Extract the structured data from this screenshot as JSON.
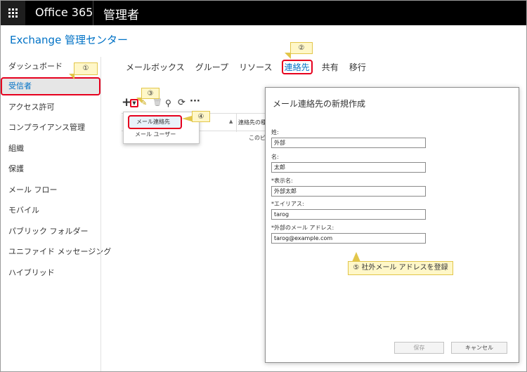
{
  "topbar": {
    "app_name": "Office 365",
    "role": "管理者"
  },
  "eac_title": "Exchange 管理センター",
  "sidebar": {
    "items": [
      {
        "label": "ダッシュボード"
      },
      {
        "label": "受信者"
      },
      {
        "label": "アクセス許可"
      },
      {
        "label": "コンプライアンス管理"
      },
      {
        "label": "組織"
      },
      {
        "label": "保護"
      },
      {
        "label": "メール フロー"
      },
      {
        "label": "モバイル"
      },
      {
        "label": "パブリック フォルダー"
      },
      {
        "label": "ユニファイド メッセージング"
      },
      {
        "label": "ハイブリッド"
      }
    ]
  },
  "tabs": [
    {
      "label": "メールボックス"
    },
    {
      "label": "グループ"
    },
    {
      "label": "リソース"
    },
    {
      "label": "連絡先"
    },
    {
      "label": "共有"
    },
    {
      "label": "移行"
    }
  ],
  "toolbar": {
    "icons": [
      "plus-icon",
      "dropdown-arrow-icon",
      "pencil-icon",
      "trash-icon",
      "search-icon",
      "refresh-icon",
      "more-icon"
    ]
  },
  "grid": {
    "column2": "連絡先の種",
    "empty_text": "このビ"
  },
  "new_menu": {
    "items": [
      {
        "label": "メール連絡先"
      },
      {
        "label": "メール ユーザー"
      }
    ]
  },
  "callouts": {
    "c1": "①",
    "c2": "②",
    "c3": "③",
    "c4": "④",
    "c5": "⑤ 社外メール アドレスを登録"
  },
  "dialog": {
    "title": "メール連絡先の新規作成",
    "fields": [
      {
        "label": "姓:",
        "value": "外部"
      },
      {
        "label": "名:",
        "value": "太郎"
      },
      {
        "label": "*表示名:",
        "value": "外部太郎"
      },
      {
        "label": "*エイリアス:",
        "value": "tarog"
      },
      {
        "label": "*外部のメール アドレス:",
        "value": "tarog@example.com"
      }
    ],
    "save_label": "保存",
    "cancel_label": "キャンセル"
  },
  "colors": {
    "accent": "#0072c6",
    "highlight_border": "#e6001e",
    "callout_fill": "#fff7c8"
  }
}
